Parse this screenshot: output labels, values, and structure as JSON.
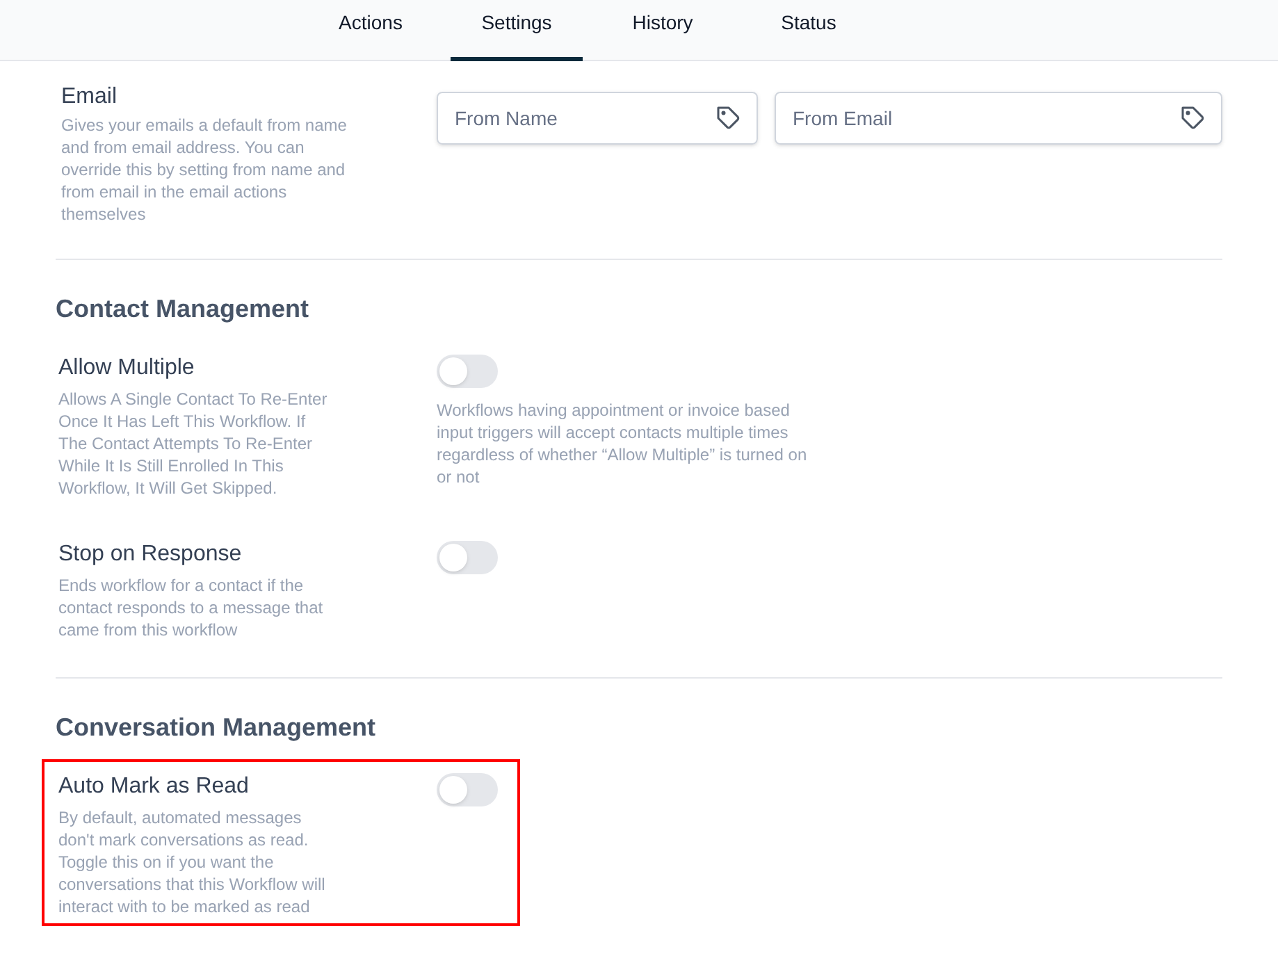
{
  "tabs": [
    {
      "label": "Actions",
      "selected": false
    },
    {
      "label": "Settings",
      "selected": true
    },
    {
      "label": "History",
      "selected": false
    },
    {
      "label": "Status",
      "selected": false
    }
  ],
  "email": {
    "title": "Email",
    "description": "Gives your emails a default from name and from email address. You can override this by setting from name and from email in the email actions themselves",
    "fields": [
      {
        "placeholder": "From Name"
      },
      {
        "placeholder": "From Email"
      }
    ]
  },
  "sections": [
    {
      "heading": "Contact Management",
      "settings": [
        {
          "title": "Allow Multiple",
          "description": "Allows A Single Contact To Re-Enter Once It Has Left This Workflow. If The Contact Attempts To Re-Enter While It Is Still Enrolled In This Workflow, It Will Get Skipped.",
          "on": false,
          "highlighted": false,
          "note": "Workflows having appointment or invoice based input triggers will accept contacts multiple times regardless of whether “Allow Multiple” is turned on or not"
        },
        {
          "title": "Stop on Response",
          "description": "Ends workflow for a contact if the contact responds to a message that came from this workflow",
          "on": false,
          "highlighted": false
        }
      ]
    },
    {
      "heading": "Conversation Management",
      "settings": [
        {
          "title": "Auto Mark as Read",
          "description": "By default, automated messages don't mark conversations as read. Toggle this on if you want the conversations that this Workflow will interact with to be marked as read",
          "on": false,
          "highlighted": true
        }
      ]
    }
  ]
}
